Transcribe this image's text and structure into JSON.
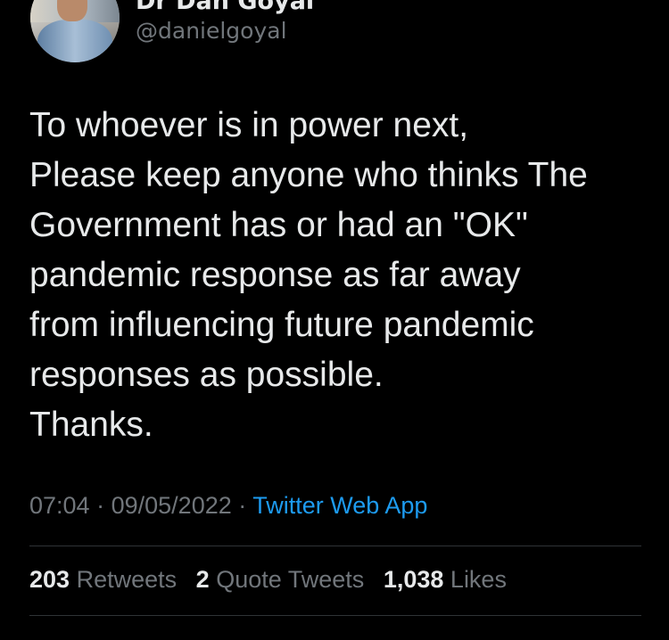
{
  "user": {
    "display_name": "Dr Dan Goyal",
    "handle": "@danielgoyal"
  },
  "tweet": {
    "lines": [
      "To whoever is in power next,",
      "Please keep anyone who thinks The",
      "Government has or had an \"OK\"",
      "pandemic response as far away",
      "from influencing future pandemic",
      "responses as possible.",
      "Thanks."
    ],
    "time": "07:04",
    "separator": "·",
    "date": "09/05/2022",
    "source": "Twitter Web App"
  },
  "stats": {
    "retweets_count": "203",
    "retweets_label": "Retweets",
    "quotes_count": "2",
    "quotes_label": "Quote Tweets",
    "likes_count": "1,038",
    "likes_label": "Likes"
  },
  "colors": {
    "background": "#000000",
    "text": "#e7e9ea",
    "muted": "#71767b",
    "link": "#1d9bf0",
    "divider": "#2f3336"
  },
  "icons": {
    "more": "more-horizontal-icon"
  }
}
